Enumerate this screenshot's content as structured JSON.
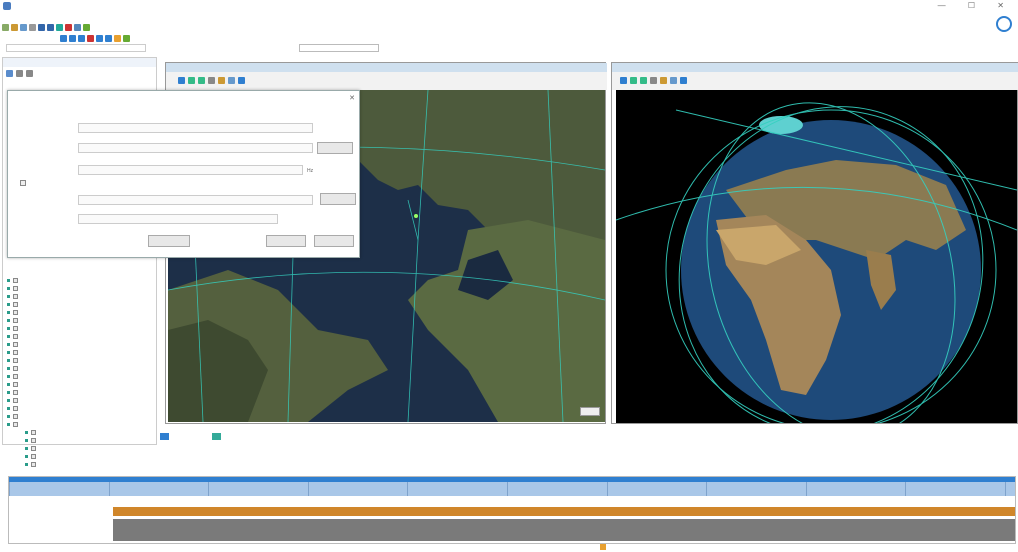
{
  "window": {
    "title": "",
    "controls": "— ☐ ✕"
  },
  "menu": [],
  "search": {
    "placeholder": ""
  },
  "time_display": "",
  "left_panel": {
    "title": "",
    "tree_items": [
      "",
      "",
      "",
      "",
      "",
      "",
      "",
      "",
      "",
      "",
      "",
      "",
      "",
      "",
      "",
      "",
      "",
      "",
      "",
      "",
      "",
      "",
      "",
      ""
    ]
  },
  "dialog": {
    "title": "",
    "fields": [
      {
        "label": "",
        "value": ""
      },
      {
        "label": "",
        "value": ""
      },
      {
        "label": "",
        "value": ""
      },
      {
        "label": "",
        "value": ""
      },
      {
        "label": "",
        "value": ""
      },
      {
        "label": "",
        "value": ""
      }
    ],
    "buttons": {
      "select": "",
      "test": "",
      "reset": "",
      "ok": "",
      "cancel": ""
    }
  },
  "map_window": {
    "tab": "",
    "sat_label": ""
  },
  "globe_window": {
    "tab": "",
    "labels": [
      "",
      "",
      "",
      "",
      ""
    ],
    "legend": ""
  },
  "view_tabs": [
    "",
    ""
  ],
  "timeline": {
    "title": "",
    "controls": [],
    "scale": [
      "",
      "",
      "",
      "",
      "",
      "",
      "",
      "",
      "",
      "",
      ""
    ],
    "row_label": "",
    "bar_text": ""
  },
  "status": {
    "right": "",
    "coords": "",
    "time": ""
  },
  "colors": {
    "accent": "#2f7fd0",
    "orbit": "#35d0c0",
    "bar": "#d0862a"
  }
}
